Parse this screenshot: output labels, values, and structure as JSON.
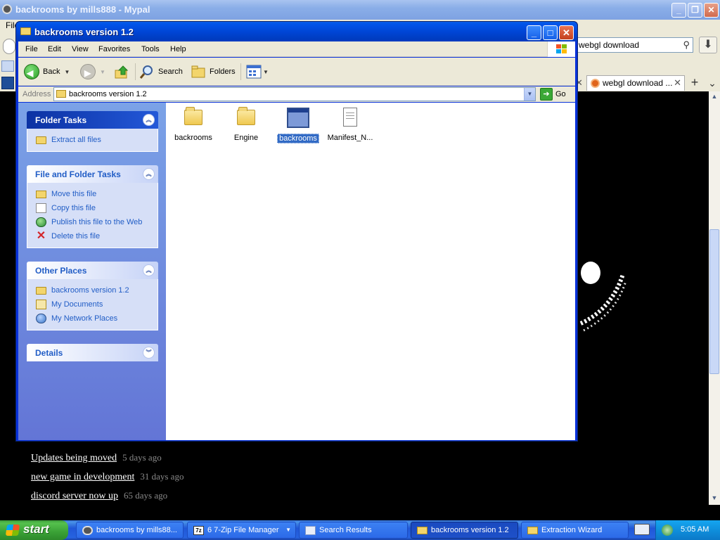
{
  "browser": {
    "title": "backrooms by mills888 - Mypal",
    "file_menu": "File",
    "search_value": "webgl download",
    "tab_label": "webgl download ...",
    "news": [
      {
        "title": "Updates being moved",
        "ago": "5 days ago"
      },
      {
        "title": "new game in development",
        "ago": "31 days ago"
      },
      {
        "title": "discord server now up",
        "ago": "65 days ago"
      }
    ]
  },
  "explorer": {
    "title": "backrooms version 1.2",
    "menu": [
      "File",
      "Edit",
      "View",
      "Favorites",
      "Tools",
      "Help"
    ],
    "toolbar": {
      "back": "Back",
      "search": "Search",
      "folders": "Folders"
    },
    "address": {
      "label": "Address",
      "value": "backrooms version 1.2",
      "go": "Go"
    },
    "panels": {
      "folder_tasks": {
        "title": "Folder Tasks",
        "items": [
          "Extract all files"
        ]
      },
      "file_tasks": {
        "title": "File and Folder Tasks",
        "items": [
          "Move this file",
          "Copy this file",
          "Publish this file to the Web",
          "Delete this file"
        ]
      },
      "other_places": {
        "title": "Other Places",
        "items": [
          "backrooms version 1.2",
          "My Documents",
          "My Network Places"
        ]
      },
      "details": {
        "title": "Details"
      }
    },
    "files": [
      {
        "name": "backrooms",
        "type": "folder"
      },
      {
        "name": "Engine",
        "type": "folder"
      },
      {
        "name": "backrooms",
        "type": "application",
        "selected": true
      },
      {
        "name": "Manifest_N...",
        "type": "document"
      }
    ]
  },
  "taskbar": {
    "start": "start",
    "buttons": [
      {
        "label": "backrooms by mills88...",
        "icon": "browser-icon"
      },
      {
        "label": "6 7-Zip File Manager",
        "icon": "seven-zip-icon"
      },
      {
        "label": "Search Results",
        "icon": "search-results-icon"
      },
      {
        "label": "backrooms version 1.2",
        "icon": "folder-icon",
        "active": true
      },
      {
        "label": "Extraction Wizard",
        "icon": "folder-icon"
      }
    ],
    "seven_zip_badge": "7z",
    "clock": "5:05 AM"
  },
  "colors": {
    "xp_blue": "#0831d9",
    "selection": "#316ac5",
    "start_green": "#3aa136",
    "link_blue": "#215dc6"
  }
}
